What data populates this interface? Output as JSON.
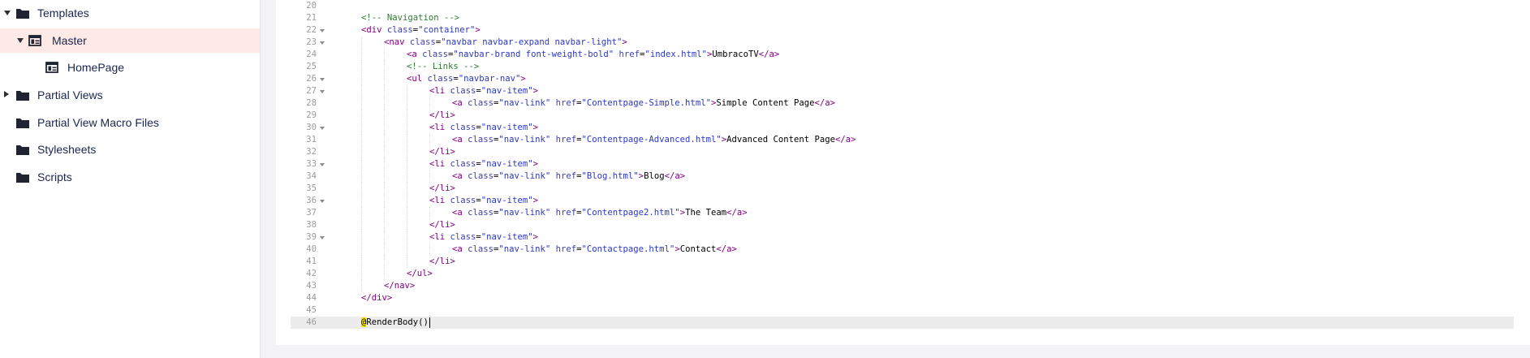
{
  "sidebar": {
    "items": [
      {
        "label": "Templates",
        "expander": "down",
        "icon": "folder-icon",
        "selected": false
      },
      {
        "label": "Master",
        "expander": "down",
        "icon": "template-icon",
        "selected": true
      },
      {
        "label": "HomePage",
        "expander": "",
        "icon": "template-icon",
        "selected": false
      },
      {
        "label": "Partial Views",
        "expander": "right",
        "icon": "folder-icon",
        "selected": false
      },
      {
        "label": "Partial View Macro Files",
        "expander": "",
        "icon": "folder-icon",
        "selected": false
      },
      {
        "label": "Stylesheets",
        "expander": "",
        "icon": "folder-icon",
        "selected": false
      },
      {
        "label": "Scripts",
        "expander": "",
        "icon": "folder-icon",
        "selected": false
      }
    ]
  },
  "editor": {
    "active_line": "46",
    "lines": [
      {
        "num": "20",
        "fold": false,
        "indent": 0,
        "tokens": []
      },
      {
        "num": "21",
        "fold": false,
        "indent": 1,
        "tokens": [
          {
            "t": "<!-- Navigation -->",
            "c": "cm"
          }
        ]
      },
      {
        "num": "22",
        "fold": true,
        "indent": 1,
        "tokens": [
          {
            "t": "<div ",
            "c": "tg"
          },
          {
            "t": "class",
            "c": "at"
          },
          {
            "t": "=",
            "c": "tx"
          },
          {
            "t": "\"container\"",
            "c": "av"
          },
          {
            "t": ">",
            "c": "tg"
          }
        ]
      },
      {
        "num": "23",
        "fold": true,
        "indent": 2,
        "tokens": [
          {
            "t": "<nav ",
            "c": "tg"
          },
          {
            "t": "class",
            "c": "at"
          },
          {
            "t": "=",
            "c": "tx"
          },
          {
            "t": "\"navbar navbar-expand navbar-light\"",
            "c": "av"
          },
          {
            "t": ">",
            "c": "tg"
          }
        ]
      },
      {
        "num": "24",
        "fold": false,
        "indent": 3,
        "tokens": [
          {
            "t": "<a ",
            "c": "tg"
          },
          {
            "t": "class",
            "c": "at"
          },
          {
            "t": "=",
            "c": "tx"
          },
          {
            "t": "\"navbar-brand font-weight-bold\"",
            "c": "av"
          },
          {
            "t": " ",
            "c": "tx"
          },
          {
            "t": "href",
            "c": "at"
          },
          {
            "t": "=",
            "c": "tx"
          },
          {
            "t": "\"index.html\"",
            "c": "av"
          },
          {
            "t": ">",
            "c": "tg"
          },
          {
            "t": "UmbracoTV",
            "c": "tx"
          },
          {
            "t": "</a>",
            "c": "tg"
          }
        ]
      },
      {
        "num": "25",
        "fold": false,
        "indent": 3,
        "tokens": [
          {
            "t": "<!-- Links -->",
            "c": "cm"
          }
        ]
      },
      {
        "num": "26",
        "fold": true,
        "indent": 3,
        "tokens": [
          {
            "t": "<ul ",
            "c": "tg"
          },
          {
            "t": "class",
            "c": "at"
          },
          {
            "t": "=",
            "c": "tx"
          },
          {
            "t": "\"navbar-nav\"",
            "c": "av"
          },
          {
            "t": ">",
            "c": "tg"
          }
        ]
      },
      {
        "num": "27",
        "fold": true,
        "indent": 4,
        "tokens": [
          {
            "t": "<li ",
            "c": "tg"
          },
          {
            "t": "class",
            "c": "at"
          },
          {
            "t": "=",
            "c": "tx"
          },
          {
            "t": "\"nav-item\"",
            "c": "av"
          },
          {
            "t": ">",
            "c": "tg"
          }
        ]
      },
      {
        "num": "28",
        "fold": false,
        "indent": 5,
        "tokens": [
          {
            "t": "<a ",
            "c": "tg"
          },
          {
            "t": "class",
            "c": "at"
          },
          {
            "t": "=",
            "c": "tx"
          },
          {
            "t": "\"nav-link\"",
            "c": "av"
          },
          {
            "t": " ",
            "c": "tx"
          },
          {
            "t": "href",
            "c": "at"
          },
          {
            "t": "=",
            "c": "tx"
          },
          {
            "t": "\"Contentpage-Simple.html\"",
            "c": "av"
          },
          {
            "t": ">",
            "c": "tg"
          },
          {
            "t": "Simple Content Page",
            "c": "tx"
          },
          {
            "t": "</a>",
            "c": "tg"
          }
        ]
      },
      {
        "num": "29",
        "fold": false,
        "indent": 4,
        "tokens": [
          {
            "t": "</li>",
            "c": "tg"
          }
        ]
      },
      {
        "num": "30",
        "fold": true,
        "indent": 4,
        "tokens": [
          {
            "t": "<li ",
            "c": "tg"
          },
          {
            "t": "class",
            "c": "at"
          },
          {
            "t": "=",
            "c": "tx"
          },
          {
            "t": "\"nav-item\"",
            "c": "av"
          },
          {
            "t": ">",
            "c": "tg"
          }
        ]
      },
      {
        "num": "31",
        "fold": false,
        "indent": 5,
        "tokens": [
          {
            "t": "<a ",
            "c": "tg"
          },
          {
            "t": "class",
            "c": "at"
          },
          {
            "t": "=",
            "c": "tx"
          },
          {
            "t": "\"nav-link\"",
            "c": "av"
          },
          {
            "t": " ",
            "c": "tx"
          },
          {
            "t": "href",
            "c": "at"
          },
          {
            "t": "=",
            "c": "tx"
          },
          {
            "t": "\"Contentpage-Advanced.html\"",
            "c": "av"
          },
          {
            "t": ">",
            "c": "tg"
          },
          {
            "t": "Advanced Content Page",
            "c": "tx"
          },
          {
            "t": "</a>",
            "c": "tg"
          }
        ]
      },
      {
        "num": "32",
        "fold": false,
        "indent": 4,
        "tokens": [
          {
            "t": "</li>",
            "c": "tg"
          }
        ]
      },
      {
        "num": "33",
        "fold": true,
        "indent": 4,
        "tokens": [
          {
            "t": "<li ",
            "c": "tg"
          },
          {
            "t": "class",
            "c": "at"
          },
          {
            "t": "=",
            "c": "tx"
          },
          {
            "t": "\"nav-item\"",
            "c": "av"
          },
          {
            "t": ">",
            "c": "tg"
          }
        ]
      },
      {
        "num": "34",
        "fold": false,
        "indent": 5,
        "tokens": [
          {
            "t": "<a ",
            "c": "tg"
          },
          {
            "t": "class",
            "c": "at"
          },
          {
            "t": "=",
            "c": "tx"
          },
          {
            "t": "\"nav-link\"",
            "c": "av"
          },
          {
            "t": " ",
            "c": "tx"
          },
          {
            "t": "href",
            "c": "at"
          },
          {
            "t": "=",
            "c": "tx"
          },
          {
            "t": "\"Blog.html\"",
            "c": "av"
          },
          {
            "t": ">",
            "c": "tg"
          },
          {
            "t": "Blog",
            "c": "tx"
          },
          {
            "t": "</a>",
            "c": "tg"
          }
        ]
      },
      {
        "num": "35",
        "fold": false,
        "indent": 4,
        "tokens": [
          {
            "t": "</li>",
            "c": "tg"
          }
        ]
      },
      {
        "num": "36",
        "fold": true,
        "indent": 4,
        "tokens": [
          {
            "t": "<li ",
            "c": "tg"
          },
          {
            "t": "class",
            "c": "at"
          },
          {
            "t": "=",
            "c": "tx"
          },
          {
            "t": "\"nav-item\"",
            "c": "av"
          },
          {
            "t": ">",
            "c": "tg"
          }
        ]
      },
      {
        "num": "37",
        "fold": false,
        "indent": 5,
        "tokens": [
          {
            "t": "<a ",
            "c": "tg"
          },
          {
            "t": "class",
            "c": "at"
          },
          {
            "t": "=",
            "c": "tx"
          },
          {
            "t": "\"nav-link\"",
            "c": "av"
          },
          {
            "t": " ",
            "c": "tx"
          },
          {
            "t": "href",
            "c": "at"
          },
          {
            "t": "=",
            "c": "tx"
          },
          {
            "t": "\"Contentpage2.html\"",
            "c": "av"
          },
          {
            "t": ">",
            "c": "tg"
          },
          {
            "t": "The Team",
            "c": "tx"
          },
          {
            "t": "</a>",
            "c": "tg"
          }
        ]
      },
      {
        "num": "38",
        "fold": false,
        "indent": 4,
        "tokens": [
          {
            "t": "</li>",
            "c": "tg"
          }
        ]
      },
      {
        "num": "39",
        "fold": true,
        "indent": 4,
        "tokens": [
          {
            "t": "<li ",
            "c": "tg"
          },
          {
            "t": "class",
            "c": "at"
          },
          {
            "t": "=",
            "c": "tx"
          },
          {
            "t": "\"nav-item\"",
            "c": "av"
          },
          {
            "t": ">",
            "c": "tg"
          }
        ]
      },
      {
        "num": "40",
        "fold": false,
        "indent": 5,
        "tokens": [
          {
            "t": "<a ",
            "c": "tg"
          },
          {
            "t": "class",
            "c": "at"
          },
          {
            "t": "=",
            "c": "tx"
          },
          {
            "t": "\"nav-link\"",
            "c": "av"
          },
          {
            "t": " ",
            "c": "tx"
          },
          {
            "t": "href",
            "c": "at"
          },
          {
            "t": "=",
            "c": "tx"
          },
          {
            "t": "\"Contactpage.html\"",
            "c": "av"
          },
          {
            "t": ">",
            "c": "tg"
          },
          {
            "t": "Contact",
            "c": "tx"
          },
          {
            "t": "</a>",
            "c": "tg"
          }
        ]
      },
      {
        "num": "41",
        "fold": false,
        "indent": 4,
        "tokens": [
          {
            "t": "</li>",
            "c": "tg"
          }
        ]
      },
      {
        "num": "42",
        "fold": false,
        "indent": 3,
        "tokens": [
          {
            "t": "</ul>",
            "c": "tg"
          }
        ]
      },
      {
        "num": "43",
        "fold": false,
        "indent": 2,
        "tokens": [
          {
            "t": "</nav>",
            "c": "tg"
          }
        ]
      },
      {
        "num": "44",
        "fold": false,
        "indent": 1,
        "tokens": [
          {
            "t": "</div>",
            "c": "tg"
          }
        ]
      },
      {
        "num": "45",
        "fold": false,
        "indent": 0,
        "tokens": []
      },
      {
        "num": "46",
        "fold": false,
        "indent": 1,
        "tokens": [
          {
            "t": "@",
            "c": "rz"
          },
          {
            "t": "RenderBody()",
            "c": "tx"
          }
        ]
      }
    ]
  },
  "colors": {
    "selected_bg": "#fde9e5",
    "tag": "#800080",
    "attr": "#4040ab",
    "attr_value": "#2a36c7",
    "comment": "#2e7d32",
    "razor_highlight": "#f7e600"
  }
}
